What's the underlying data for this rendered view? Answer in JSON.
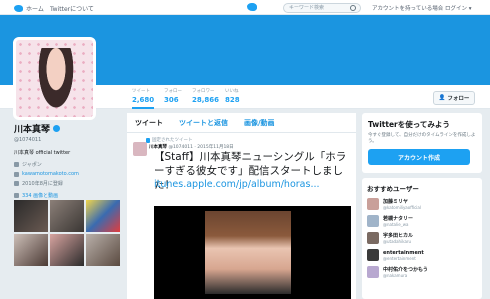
{
  "topnav": {
    "home": "ホーム",
    "about": "Twitterについて",
    "search_placeholder": "キーワード検索",
    "login": "アカウントを持っている場合 ログイン ▾"
  },
  "profile_stats": [
    {
      "label": "ツイート",
      "value": "2,680"
    },
    {
      "label": "フォロー",
      "value": "306"
    },
    {
      "label": "フォロワー",
      "value": "28,866"
    },
    {
      "label": "いいね",
      "value": "828"
    }
  ],
  "follow_button": "フォロー",
  "profile": {
    "name": "川本真琴",
    "handle": "@1074011",
    "bio": "川本真琴 official twitter",
    "location": "ジャポン",
    "website": "kawamotomakoto.com",
    "joined": "2010年8月に登録",
    "photos_label": "334 画像と動画"
  },
  "timeline": {
    "tabs": [
      "ツイート",
      "ツイートと返信",
      "画像/動画"
    ],
    "pinned_label": "固定されたツイート",
    "tweet_author": "川本真琴",
    "tweet_meta": "@1074011 · 2015年11月18日",
    "tweet_text": "【Staff】川本真琴ニューシングル「ホラーすぎる彼女です」配信スタートしました！",
    "tweet_link": "itunes.apple.com/jp/album/horas..."
  },
  "signup": {
    "title": "Twitterを使ってみよう",
    "body": "今すぐ登録して、自分だけのタイムラインを作成しよう。",
    "button": "アカウント作成"
  },
  "recommendations": {
    "title": "おすすめユーザー",
    "users": [
      {
        "name": "加藤ミリヤ",
        "handle": "@katomiliyaofficial"
      },
      {
        "name": "若槻ナタリー",
        "handle": "@natalie_wa"
      },
      {
        "name": "宇多田ヒカル",
        "handle": "@utadahikaru"
      },
      {
        "name": "entertainment",
        "handle": "@entertainment"
      },
      {
        "name": "中村佑介をつかもう",
        "handle": "@nakamura"
      }
    ]
  },
  "colors": {
    "accent": "#1da1f2",
    "banner": "#1b95e0",
    "background": "#e6ecf0"
  }
}
